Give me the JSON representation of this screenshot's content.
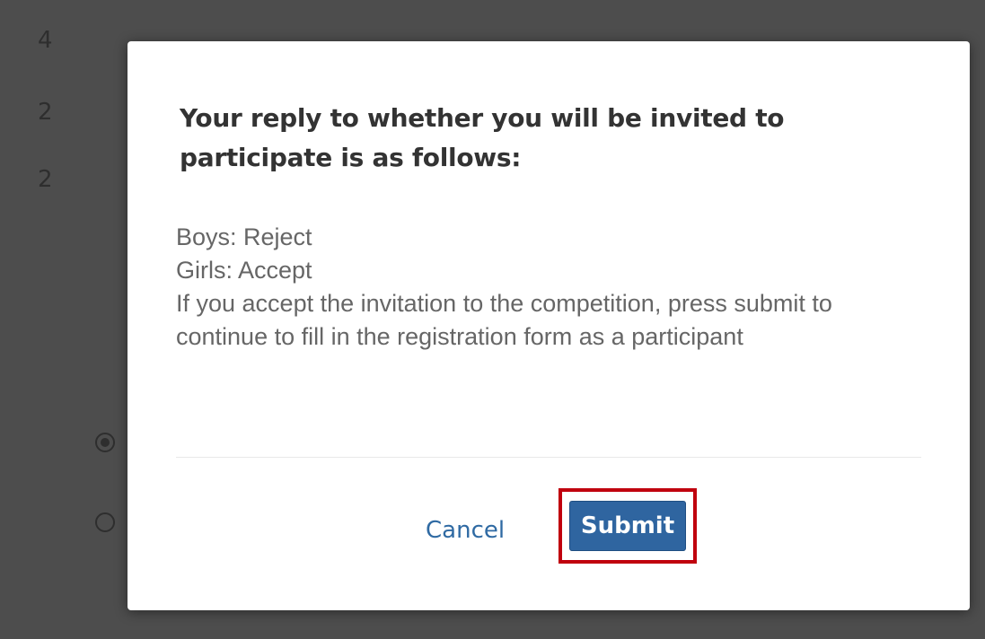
{
  "background": {
    "numbers": [
      "4",
      "2",
      "2"
    ]
  },
  "dialog": {
    "title": "Your reply to whether you will be invited to participate is as follows:",
    "body_lines": [
      "Boys: Reject",
      "Girls: Accept",
      "If you accept the invitation to the competition, press submit to continue to fill in the registration form as a participant"
    ],
    "cancel_label": "Cancel",
    "submit_label": "Submit"
  },
  "colors": {
    "primary_button": "#2f65a0",
    "link": "#2f6aa3",
    "highlight": "#c0000e",
    "overlay": "#4d4d4d"
  }
}
